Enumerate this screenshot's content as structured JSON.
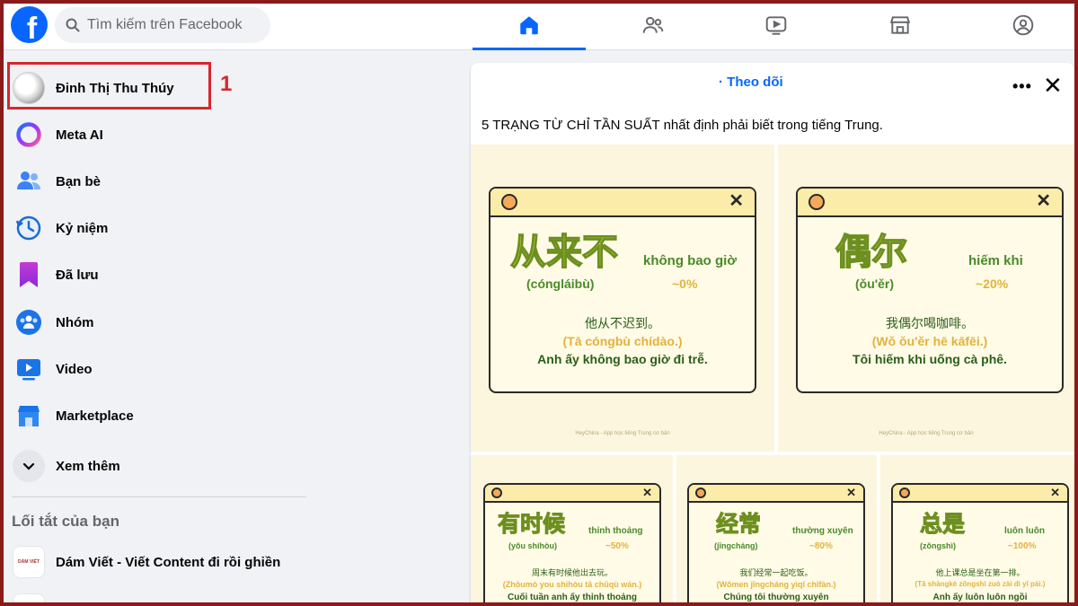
{
  "topbar": {
    "logo_letter": "f",
    "search_placeholder": "Tìm kiếm trên Facebook",
    "tabs": [
      {
        "icon": "home-icon",
        "active": true
      },
      {
        "icon": "friends-icon",
        "active": false
      },
      {
        "icon": "video-icon",
        "active": false
      },
      {
        "icon": "marketplace-icon",
        "active": false
      },
      {
        "icon": "gaming-icon",
        "active": false
      }
    ]
  },
  "sidebar": {
    "items": [
      {
        "label": "Đinh Thị Thu Thúy",
        "icon": "profile-avatar"
      },
      {
        "label": "Meta AI",
        "icon": "meta-ai-icon"
      },
      {
        "label": "Bạn bè",
        "icon": "friends-icon"
      },
      {
        "label": "Kỷ niệm",
        "icon": "memories-icon"
      },
      {
        "label": "Đã lưu",
        "icon": "saved-icon"
      },
      {
        "label": "Nhóm",
        "icon": "groups-icon"
      },
      {
        "label": "Video",
        "icon": "video-icon"
      },
      {
        "label": "Marketplace",
        "icon": "marketplace-icon"
      },
      {
        "label": "Xem thêm",
        "icon": "chevron-down-icon"
      }
    ],
    "shortcuts_title": "Lối tắt của bạn",
    "shortcuts": [
      {
        "label": "Dám Viết - Viết Content đi rồi ghiền",
        "thumb_text": "DÁM VIẾT"
      }
    ],
    "annotation_number": "1"
  },
  "post": {
    "follow_label": "· Theo dõi",
    "caption": "5 TRẠNG TỪ CHỈ TẦN SUẤT nhất định phải biết trong tiếng Trung.",
    "credit": "HeyChina - App học tiếng Trung cơ bản",
    "cards": [
      {
        "hanzi": "从来不",
        "meaning": "không bao giờ",
        "pinyin": "(cóngláibù)",
        "percent": "~0%",
        "ex_zh": "他从不迟到。",
        "ex_py": "(Tā cóngbù chídào.)",
        "ex_vi": "Anh ấy không bao giờ đi trễ."
      },
      {
        "hanzi": "偶尔",
        "meaning": "hiếm khi",
        "pinyin": "(ǒu'ěr)",
        "percent": "~20%",
        "ex_zh": "我偶尔喝咖啡。",
        "ex_py": "(Wǒ ǒu'ěr hē kāfēi.)",
        "ex_vi": "Tôi hiếm khi uống cà phê."
      },
      {
        "hanzi": "有时候",
        "meaning": "thỉnh thoảng",
        "pinyin": "(yǒu shíhòu)",
        "percent": "~50%",
        "ex_zh": "周末有时候他出去玩。",
        "ex_py": "(Zhōumò you shíhòu tā chūqù wán.)",
        "ex_vi": "Cuối tuần anh ấy thỉnh thoảng"
      },
      {
        "hanzi": "经常",
        "meaning": "thường xuyên",
        "pinyin": "(jīngcháng)",
        "percent": "~80%",
        "ex_zh": "我们经常一起吃饭。",
        "ex_py": "(Wǒmen jīngcháng yìqǐ chīfàn.)",
        "ex_vi": "Chúng tôi thường xuyên"
      },
      {
        "hanzi": "总是",
        "meaning": "luôn luôn",
        "pinyin": "(zǒngshì)",
        "percent": "~100%",
        "ex_zh": "他上课总是坐在第一排。",
        "ex_py": "(Tā shàngkè zǒngshì zuò zài dì yī pái.)",
        "ex_vi": "Anh ấy luôn luôn ngồi"
      }
    ]
  },
  "colors": {
    "brand": "#0866ff",
    "annotation": "#d7262e",
    "card_background": "#fbf6dd",
    "hanzi_fill": "#cbd54a",
    "text_green": "#2b5e1a",
    "pinyin_yellow": "#e3b23c"
  }
}
